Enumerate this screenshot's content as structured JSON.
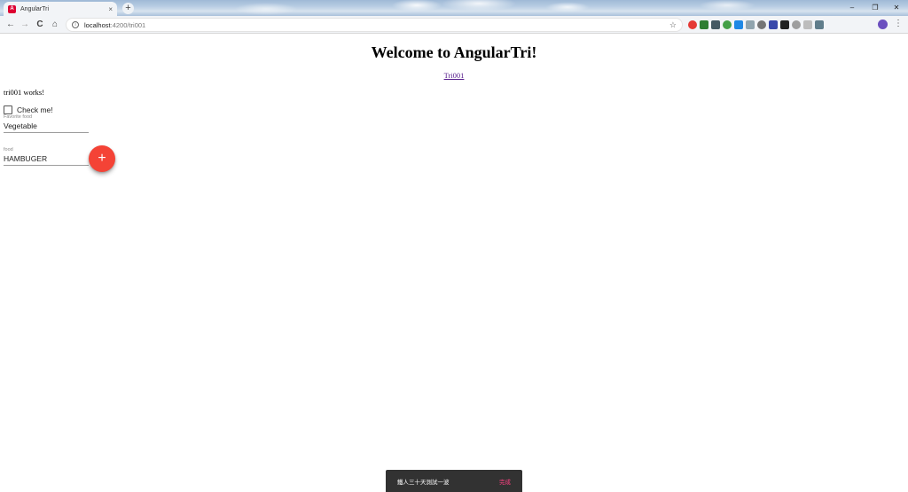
{
  "browser": {
    "tab_title": "AngularTri",
    "tab_close": "×",
    "new_tab": "+",
    "url_host": "localhost",
    "url_path": ":4200/tri001",
    "nav": {
      "back": "←",
      "forward": "→",
      "reload": "C",
      "home": "⌂"
    },
    "window": {
      "minimize": "–",
      "restore": "❐",
      "close": "✕"
    },
    "extension_colors": [
      "#e53935",
      "#2e7d32",
      "#455a64",
      "#43a047",
      "#1e88e5",
      "#90a4ae",
      "#757575",
      "#3949ab",
      "#212121",
      "#9e9e9e",
      "#bdbdbd",
      "#607d8b"
    ]
  },
  "page": {
    "heading": "Welcome to AngularTri!",
    "route_link": "Tri001",
    "component_text": "tri001 works!",
    "checkbox_label": "Check me!",
    "favorite_food": {
      "label": "Favorite food",
      "value": "Vegetable"
    },
    "food": {
      "label": "food",
      "value": "HAMBUGER"
    },
    "fab_label": "+"
  },
  "snackbar": {
    "message": "鐵人三十天測試一波",
    "action": "完成"
  },
  "colors": {
    "fab": "#f44336",
    "snackbar_bg": "#323232",
    "snackbar_action": "#ff4081",
    "link_visited": "#551a8b"
  }
}
